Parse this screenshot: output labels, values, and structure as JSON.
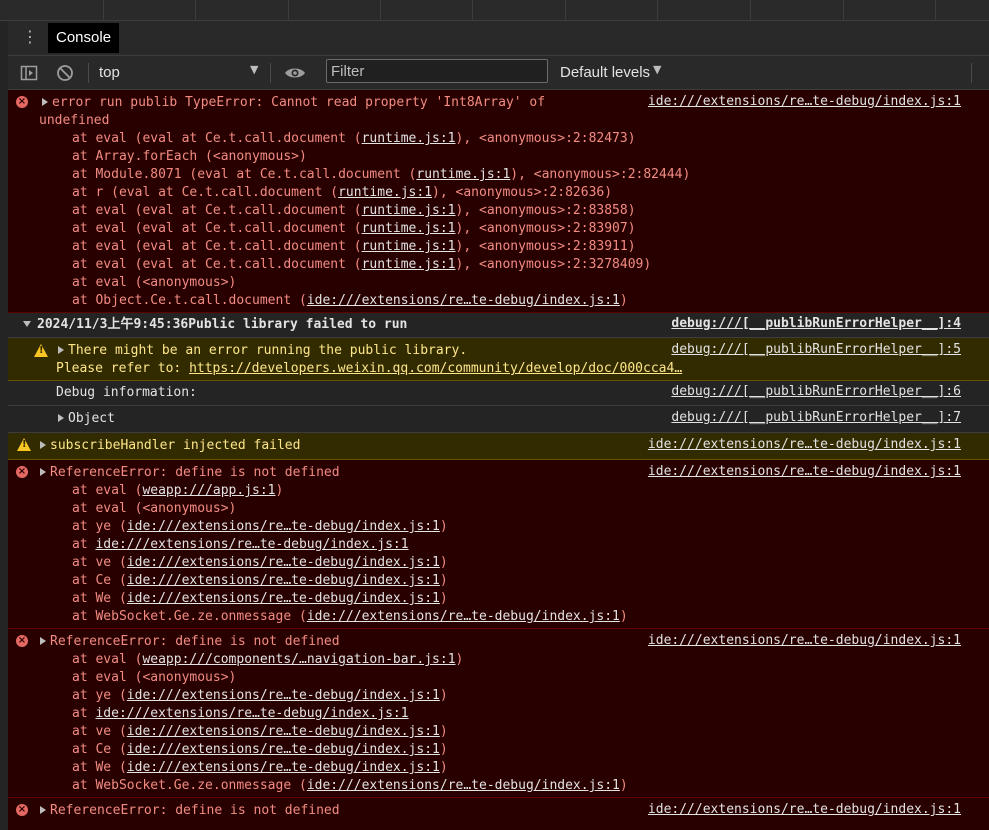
{
  "tabs": {
    "active": "Console",
    "menu_icon": "kebab-menu-icon"
  },
  "toolbar": {
    "context": "top",
    "filter_placeholder": "Filter",
    "levels": "Default levels"
  },
  "messages": {
    "m1": {
      "line1": "error run publib TypeError: Cannot read property 'Int8Array' of",
      "line2": "undefined",
      "src": "ide:///extensions/re…te-debug/index.js:1",
      "stack": [
        {
          "pre": "at eval (eval at Ce.t.call.document (",
          "link": "runtime.js:1",
          "post": "), <anonymous>:2:82473)"
        },
        {
          "pre": "at Array.forEach (<anonymous>)",
          "link": "",
          "post": ""
        },
        {
          "pre": "at Module.8071 (eval at Ce.t.call.document (",
          "link": "runtime.js:1",
          "post": "), <anonymous>:2:82444)"
        },
        {
          "pre": "at r (eval at Ce.t.call.document (",
          "link": "runtime.js:1",
          "post": "), <anonymous>:2:82636)"
        },
        {
          "pre": "at eval (eval at Ce.t.call.document (",
          "link": "runtime.js:1",
          "post": "), <anonymous>:2:83858)"
        },
        {
          "pre": "at eval (eval at Ce.t.call.document (",
          "link": "runtime.js:1",
          "post": "), <anonymous>:2:83907)"
        },
        {
          "pre": "at eval (eval at Ce.t.call.document (",
          "link": "runtime.js:1",
          "post": "), <anonymous>:2:83911)"
        },
        {
          "pre": "at eval (eval at Ce.t.call.document (",
          "link": "runtime.js:1",
          "post": "), <anonymous>:2:3278409)"
        },
        {
          "pre": "at eval (<anonymous>)",
          "link": "",
          "post": ""
        },
        {
          "pre": "at Object.Ce.t.call.document (",
          "link": "ide:///extensions/re…te-debug/index.js:1",
          "post": ")"
        }
      ]
    },
    "group": {
      "text": "2024/11/3上午9:45:36Public library failed to run",
      "src": "debug:///[__publibRunErrorHelper__]:4"
    },
    "warn1": {
      "line1": "There might be an error running the public library.",
      "line2_pre": "Please refer to: ",
      "line2_link": "https://developers.weixin.qq.com/community/develop/doc/000cca4…",
      "src": "debug:///[__publibRunErrorHelper__]:5"
    },
    "info1": {
      "text": "Debug information:",
      "src": "debug:///[__publibRunErrorHelper__]:6"
    },
    "info2": {
      "text": "Object",
      "src": "debug:///[__publibRunErrorHelper__]:7"
    },
    "warn2": {
      "text": "subscribeHandler injected failed",
      "src": "ide:///extensions/re…te-debug/index.js:1"
    },
    "ref1": {
      "text": "ReferenceError: define is not defined",
      "src": "ide:///extensions/re…te-debug/index.js:1",
      "stack": [
        {
          "pre": "at eval (",
          "link": "weapp:///app.js:1",
          "post": ")"
        },
        {
          "pre": "at eval (<anonymous>)",
          "link": "",
          "post": ""
        },
        {
          "pre": "at ye (",
          "link": "ide:///extensions/re…te-debug/index.js:1",
          "post": ")"
        },
        {
          "pre": "at ",
          "link": "ide:///extensions/re…te-debug/index.js:1",
          "post": ""
        },
        {
          "pre": "at ve (",
          "link": "ide:///extensions/re…te-debug/index.js:1",
          "post": ")"
        },
        {
          "pre": "at Ce (",
          "link": "ide:///extensions/re…te-debug/index.js:1",
          "post": ")"
        },
        {
          "pre": "at We (",
          "link": "ide:///extensions/re…te-debug/index.js:1",
          "post": ")"
        },
        {
          "pre": "at WebSocket.Ge.ze.onmessage (",
          "link": "ide:///extensions/re…te-debug/index.js:1",
          "post": ")"
        }
      ]
    },
    "ref2": {
      "text": "ReferenceError: define is not defined",
      "src": "ide:///extensions/re…te-debug/index.js:1",
      "stack": [
        {
          "pre": "at eval (",
          "link": "weapp:///components/…navigation-bar.js:1",
          "post": ")"
        },
        {
          "pre": "at eval (<anonymous>)",
          "link": "",
          "post": ""
        },
        {
          "pre": "at ye (",
          "link": "ide:///extensions/re…te-debug/index.js:1",
          "post": ")"
        },
        {
          "pre": "at ",
          "link": "ide:///extensions/re…te-debug/index.js:1",
          "post": ""
        },
        {
          "pre": "at ve (",
          "link": "ide:///extensions/re…te-debug/index.js:1",
          "post": ")"
        },
        {
          "pre": "at Ce (",
          "link": "ide:///extensions/re…te-debug/index.js:1",
          "post": ")"
        },
        {
          "pre": "at We (",
          "link": "ide:///extensions/re…te-debug/index.js:1",
          "post": ")"
        },
        {
          "pre": "at WebSocket.Ge.ze.onmessage (",
          "link": "ide:///extensions/re…te-debug/index.js:1",
          "post": ")"
        }
      ]
    },
    "ref3": {
      "text": "ReferenceError: define is not defined",
      "src": "ide:///extensions/re…te-debug/index.js:1"
    }
  }
}
